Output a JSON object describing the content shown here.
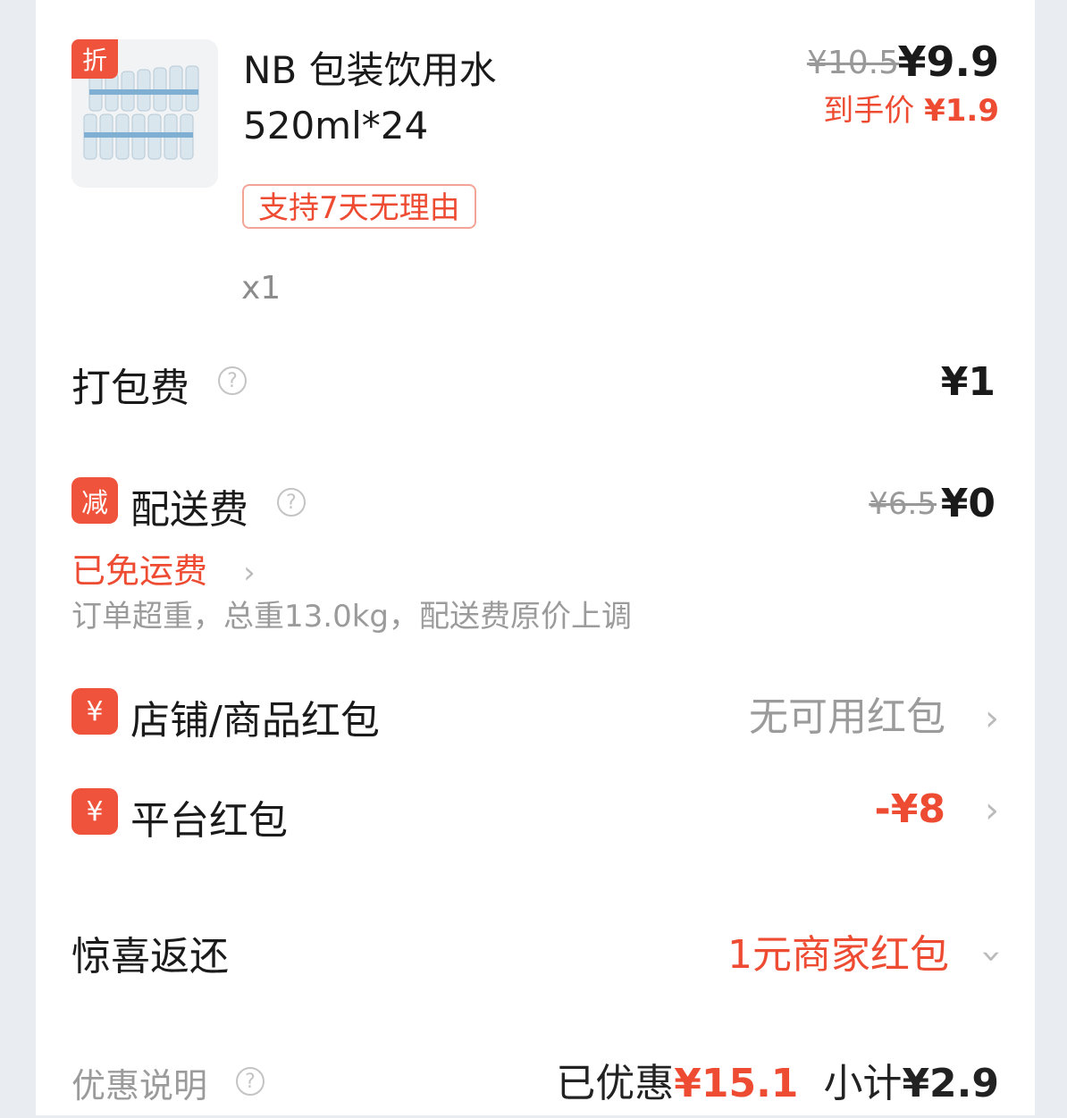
{
  "product": {
    "badge": "折",
    "name": "NB 包装饮用水 520ml*24",
    "tag": "支持7天无理由",
    "qty": "x1",
    "original_price": "¥10.5",
    "price": "¥9.9",
    "final_label": "到手价",
    "final_price": "¥1.9"
  },
  "packing": {
    "label": "打包费",
    "help": "?",
    "value": "¥1"
  },
  "delivery": {
    "badge": "减",
    "label": "配送费",
    "help": "?",
    "original": "¥6.5",
    "value": "¥0",
    "free_text": "已免运费",
    "note": "订单超重，总重13.0kg，配送费原价上调"
  },
  "shop_coupon": {
    "badge": "¥",
    "label": "店铺/商品红包",
    "value": "无可用红包"
  },
  "platform_coupon": {
    "badge": "¥",
    "label": "平台红包",
    "value": "-¥8"
  },
  "surprise": {
    "label": "惊喜返还",
    "value": "1元商家红包"
  },
  "summary": {
    "label": "优惠说明",
    "help": "?",
    "saved_label": "已优惠",
    "saved_value": "¥15.1",
    "subtotal_label": "小计",
    "subtotal_value": "¥2.9"
  },
  "colors": {
    "accent": "#ee4b33",
    "badge": "#f0533b",
    "muted": "#9b9b9b"
  }
}
